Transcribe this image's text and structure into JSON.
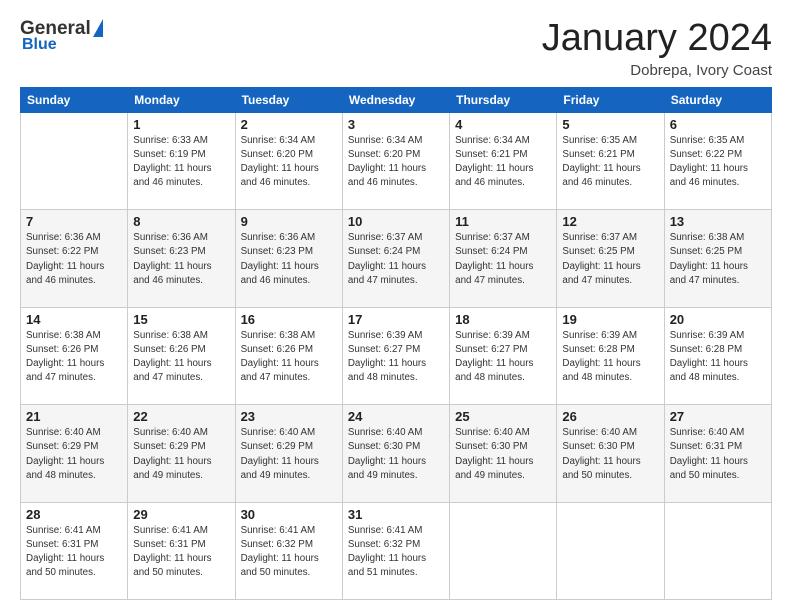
{
  "header": {
    "logo_general": "General",
    "logo_blue": "Blue",
    "title": "January 2024",
    "location": "Dobrepa, Ivory Coast"
  },
  "weekdays": [
    "Sunday",
    "Monday",
    "Tuesday",
    "Wednesday",
    "Thursday",
    "Friday",
    "Saturday"
  ],
  "weeks": [
    [
      {
        "day": "",
        "info": ""
      },
      {
        "day": "1",
        "info": "Sunrise: 6:33 AM\nSunset: 6:19 PM\nDaylight: 11 hours\nand 46 minutes."
      },
      {
        "day": "2",
        "info": "Sunrise: 6:34 AM\nSunset: 6:20 PM\nDaylight: 11 hours\nand 46 minutes."
      },
      {
        "day": "3",
        "info": "Sunrise: 6:34 AM\nSunset: 6:20 PM\nDaylight: 11 hours\nand 46 minutes."
      },
      {
        "day": "4",
        "info": "Sunrise: 6:34 AM\nSunset: 6:21 PM\nDaylight: 11 hours\nand 46 minutes."
      },
      {
        "day": "5",
        "info": "Sunrise: 6:35 AM\nSunset: 6:21 PM\nDaylight: 11 hours\nand 46 minutes."
      },
      {
        "day": "6",
        "info": "Sunrise: 6:35 AM\nSunset: 6:22 PM\nDaylight: 11 hours\nand 46 minutes."
      }
    ],
    [
      {
        "day": "7",
        "info": "Sunrise: 6:36 AM\nSunset: 6:22 PM\nDaylight: 11 hours\nand 46 minutes."
      },
      {
        "day": "8",
        "info": "Sunrise: 6:36 AM\nSunset: 6:23 PM\nDaylight: 11 hours\nand 46 minutes."
      },
      {
        "day": "9",
        "info": "Sunrise: 6:36 AM\nSunset: 6:23 PM\nDaylight: 11 hours\nand 46 minutes."
      },
      {
        "day": "10",
        "info": "Sunrise: 6:37 AM\nSunset: 6:24 PM\nDaylight: 11 hours\nand 47 minutes."
      },
      {
        "day": "11",
        "info": "Sunrise: 6:37 AM\nSunset: 6:24 PM\nDaylight: 11 hours\nand 47 minutes."
      },
      {
        "day": "12",
        "info": "Sunrise: 6:37 AM\nSunset: 6:25 PM\nDaylight: 11 hours\nand 47 minutes."
      },
      {
        "day": "13",
        "info": "Sunrise: 6:38 AM\nSunset: 6:25 PM\nDaylight: 11 hours\nand 47 minutes."
      }
    ],
    [
      {
        "day": "14",
        "info": "Sunrise: 6:38 AM\nSunset: 6:26 PM\nDaylight: 11 hours\nand 47 minutes."
      },
      {
        "day": "15",
        "info": "Sunrise: 6:38 AM\nSunset: 6:26 PM\nDaylight: 11 hours\nand 47 minutes."
      },
      {
        "day": "16",
        "info": "Sunrise: 6:38 AM\nSunset: 6:26 PM\nDaylight: 11 hours\nand 47 minutes."
      },
      {
        "day": "17",
        "info": "Sunrise: 6:39 AM\nSunset: 6:27 PM\nDaylight: 11 hours\nand 48 minutes."
      },
      {
        "day": "18",
        "info": "Sunrise: 6:39 AM\nSunset: 6:27 PM\nDaylight: 11 hours\nand 48 minutes."
      },
      {
        "day": "19",
        "info": "Sunrise: 6:39 AM\nSunset: 6:28 PM\nDaylight: 11 hours\nand 48 minutes."
      },
      {
        "day": "20",
        "info": "Sunrise: 6:39 AM\nSunset: 6:28 PM\nDaylight: 11 hours\nand 48 minutes."
      }
    ],
    [
      {
        "day": "21",
        "info": "Sunrise: 6:40 AM\nSunset: 6:29 PM\nDaylight: 11 hours\nand 48 minutes."
      },
      {
        "day": "22",
        "info": "Sunrise: 6:40 AM\nSunset: 6:29 PM\nDaylight: 11 hours\nand 49 minutes."
      },
      {
        "day": "23",
        "info": "Sunrise: 6:40 AM\nSunset: 6:29 PM\nDaylight: 11 hours\nand 49 minutes."
      },
      {
        "day": "24",
        "info": "Sunrise: 6:40 AM\nSunset: 6:30 PM\nDaylight: 11 hours\nand 49 minutes."
      },
      {
        "day": "25",
        "info": "Sunrise: 6:40 AM\nSunset: 6:30 PM\nDaylight: 11 hours\nand 49 minutes."
      },
      {
        "day": "26",
        "info": "Sunrise: 6:40 AM\nSunset: 6:30 PM\nDaylight: 11 hours\nand 50 minutes."
      },
      {
        "day": "27",
        "info": "Sunrise: 6:40 AM\nSunset: 6:31 PM\nDaylight: 11 hours\nand 50 minutes."
      }
    ],
    [
      {
        "day": "28",
        "info": "Sunrise: 6:41 AM\nSunset: 6:31 PM\nDaylight: 11 hours\nand 50 minutes."
      },
      {
        "day": "29",
        "info": "Sunrise: 6:41 AM\nSunset: 6:31 PM\nDaylight: 11 hours\nand 50 minutes."
      },
      {
        "day": "30",
        "info": "Sunrise: 6:41 AM\nSunset: 6:32 PM\nDaylight: 11 hours\nand 50 minutes."
      },
      {
        "day": "31",
        "info": "Sunrise: 6:41 AM\nSunset: 6:32 PM\nDaylight: 11 hours\nand 51 minutes."
      },
      {
        "day": "",
        "info": ""
      },
      {
        "day": "",
        "info": ""
      },
      {
        "day": "",
        "info": ""
      }
    ]
  ]
}
